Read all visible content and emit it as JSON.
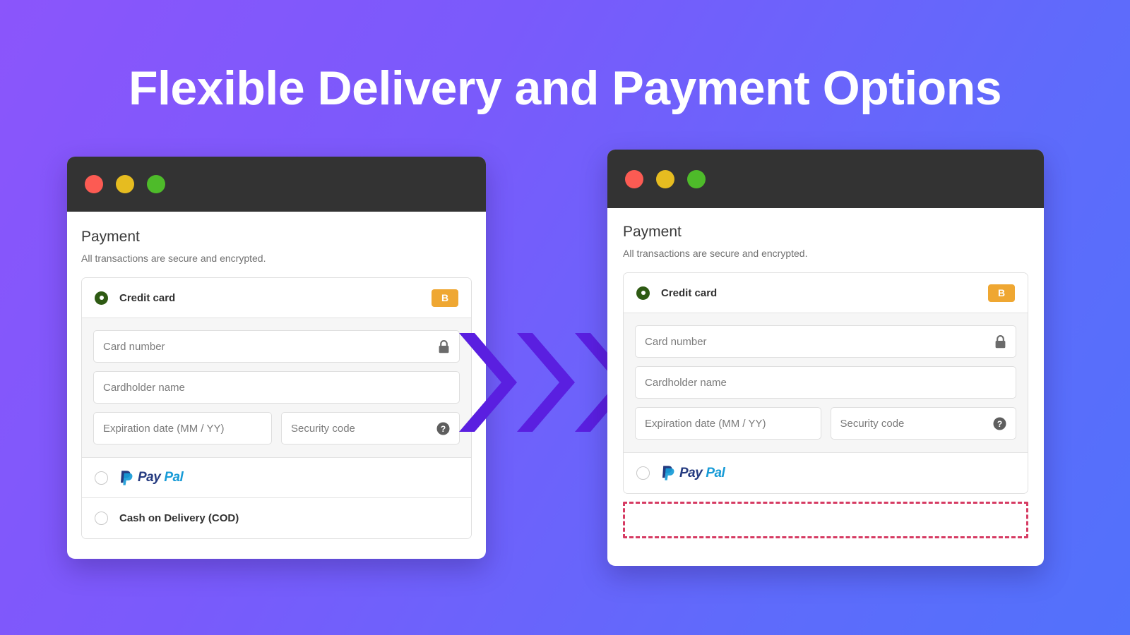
{
  "headline": "Flexible Delivery and Payment Options",
  "colors": {
    "background_start": "#8B55FB",
    "background_end": "#5271FB",
    "arrow": "#5A1FE0",
    "badge": "#EFA732",
    "radio_selected": "#2E5A13",
    "dashed_highlight": "#D63B63",
    "titlebar": "#333333",
    "dot_red": "#FC5B53",
    "dot_yellow": "#E6BC20",
    "dot_green": "#4EBB2A"
  },
  "before_window": {
    "title_dots": [
      "close-dot",
      "minimize-dot",
      "maximize-dot"
    ],
    "heading": "Payment",
    "subheading": "All transactions are secure and encrypted.",
    "options": [
      {
        "label": "Credit card",
        "selected": true,
        "badge": "B",
        "form": {
          "card_number": "Card number",
          "card_number_icon": "lock-icon",
          "cardholder_name": "Cardholder name",
          "expiration": "Expiration date (MM / YY)",
          "security_code": "Security code",
          "security_code_icon": "help-icon"
        }
      },
      {
        "label": "PayPal",
        "selected": false,
        "logo": "paypal-logo",
        "logo_parts": [
          "Pay",
          "Pal"
        ]
      },
      {
        "label": "Cash on Delivery (COD)",
        "selected": false
      }
    ]
  },
  "after_window": {
    "title_dots": [
      "close-dot",
      "minimize-dot",
      "maximize-dot"
    ],
    "heading": "Payment",
    "subheading": "All transactions are secure and encrypted.",
    "options": [
      {
        "label": "Credit card",
        "selected": true,
        "badge": "B",
        "form": {
          "card_number": "Card number",
          "card_number_icon": "lock-icon",
          "cardholder_name": "Cardholder name",
          "expiration": "Expiration date (MM / YY)",
          "security_code": "Security code",
          "security_code_icon": "help-icon"
        }
      },
      {
        "label": "PayPal",
        "selected": false,
        "logo": "paypal-logo",
        "logo_parts": [
          "Pay",
          "Pal"
        ]
      }
    ],
    "removed_placeholder": ""
  },
  "arrows": {
    "count": 3,
    "direction": "right"
  }
}
